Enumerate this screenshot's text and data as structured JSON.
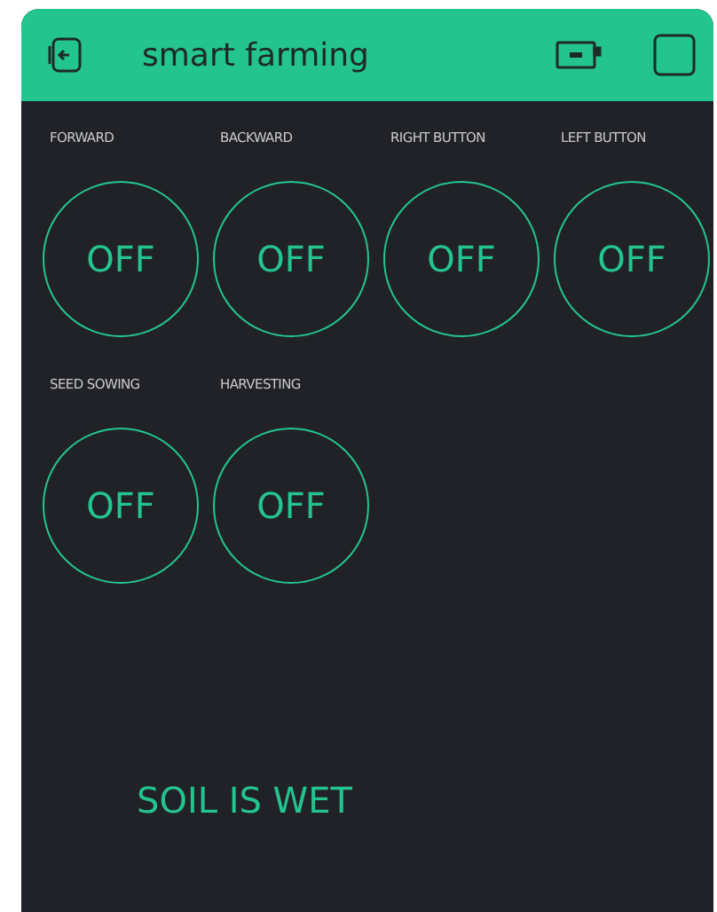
{
  "header": {
    "title": "smart farming"
  },
  "buttons": [
    {
      "label": "FORWARD",
      "text": "OFF",
      "on": false
    },
    {
      "label": "BACKWARD",
      "text": "OFF",
      "on": false
    },
    {
      "label": "RIGHT BUTTON",
      "text": "OFF",
      "on": false
    },
    {
      "label": "LEFT BUTTON",
      "text": "OFF",
      "on": false
    },
    {
      "label": "SEED SOWING",
      "text": "OFF",
      "on": false
    },
    {
      "label": "HARVESTING",
      "text": "OFF",
      "on": false
    }
  ],
  "status": "SOIL IS WET"
}
